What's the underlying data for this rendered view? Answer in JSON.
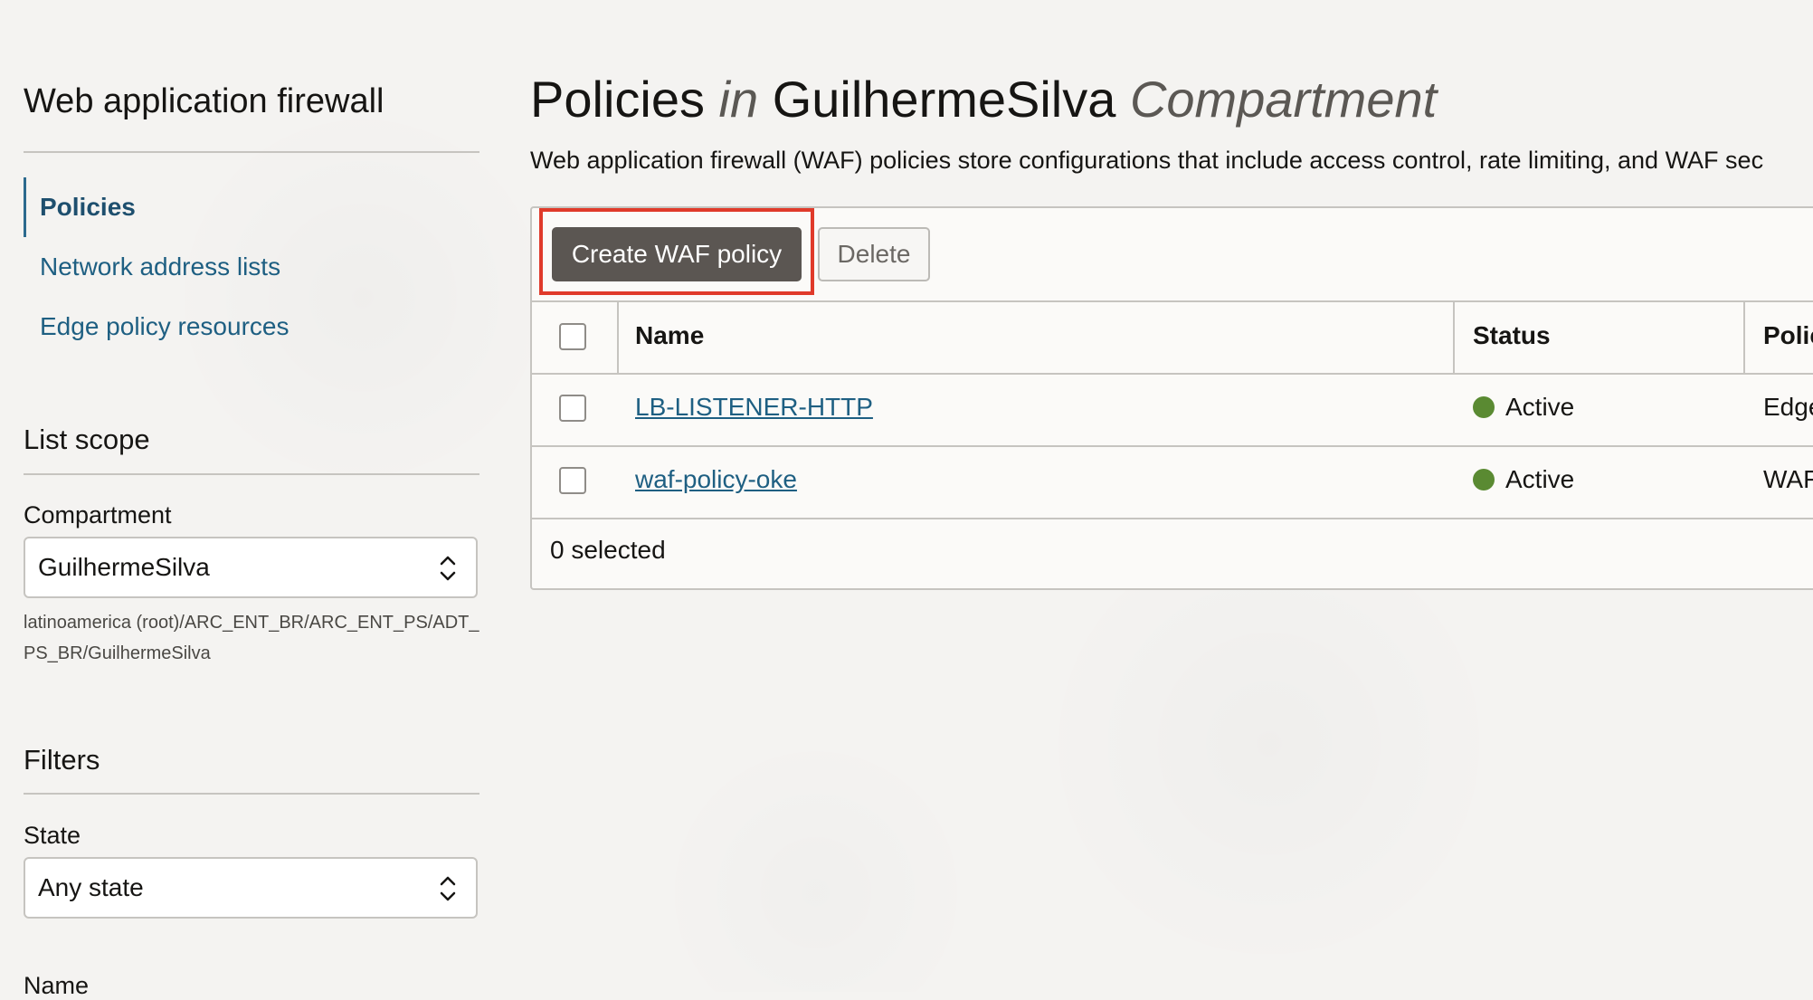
{
  "sidebar": {
    "title": "Web application firewall",
    "nav_items": [
      {
        "label": "Policies",
        "active": true
      },
      {
        "label": "Network address lists",
        "active": false
      },
      {
        "label": "Edge policy resources",
        "active": false
      }
    ],
    "list_scope": {
      "heading": "List scope",
      "compartment_label": "Compartment",
      "compartment_value": "GuilhermeSilva",
      "compartment_path": "latinoamerica (root)/ARC_ENT_BR/ARC_ENT_PS/ADT_PS_BR/GuilhermeSilva"
    },
    "filters": {
      "heading": "Filters",
      "state_label": "State",
      "state_value": "Any state",
      "name_label": "Name"
    }
  },
  "main": {
    "title_prefix": "Policies",
    "title_in": "in",
    "title_compartment": "GuilhermeSilva",
    "title_suffix": "Compartment",
    "description": "Web application firewall (WAF) policies store configurations that include access control, rate limiting, and WAF sec",
    "toolbar": {
      "create_label": "Create WAF policy",
      "delete_label": "Delete"
    },
    "table": {
      "headers": {
        "name": "Name",
        "status": "Status",
        "policy": "Polic"
      },
      "rows": [
        {
          "name": "LB-LISTENER-HTTP",
          "status": "Active",
          "policy": "Edge"
        },
        {
          "name": "waf-policy-oke",
          "status": "Active",
          "policy": "WAF"
        }
      ],
      "footer": "0 selected"
    }
  },
  "colors": {
    "accent_link": "#1e5f82",
    "status_active": "#5a8a32",
    "highlight": "#e03a2a",
    "primary_button": "#5b5652"
  }
}
